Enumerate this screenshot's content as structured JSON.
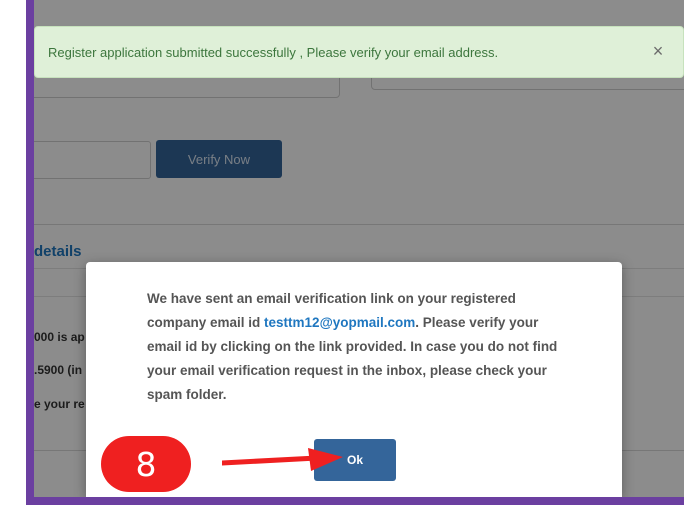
{
  "alert": {
    "message": "Register application submitted successfully , Please verify your email address.",
    "close_glyph": "×"
  },
  "background": {
    "verify_button_label": "Verify Now",
    "section_title": "details",
    "line1": "000 is ap",
    "line2": ".5900 (in",
    "line3": "e your re"
  },
  "modal": {
    "text_before": "We have sent an email verification link on your registered company email id ",
    "email": "testtm12@yopmail.com",
    "text_after": ". Please verify your email id by clicking on the link provided. In case you do not find your email verification request in the inbox, please check your spam folder.",
    "ok_label": "Ok"
  },
  "annotation": {
    "step_number": "8"
  },
  "colors": {
    "frame": "#6b3fa0",
    "button": "#34659a",
    "link": "#1f77c0",
    "alert_bg": "#dff0d8",
    "alert_text": "#3c763d",
    "badge": "#ef2020"
  }
}
